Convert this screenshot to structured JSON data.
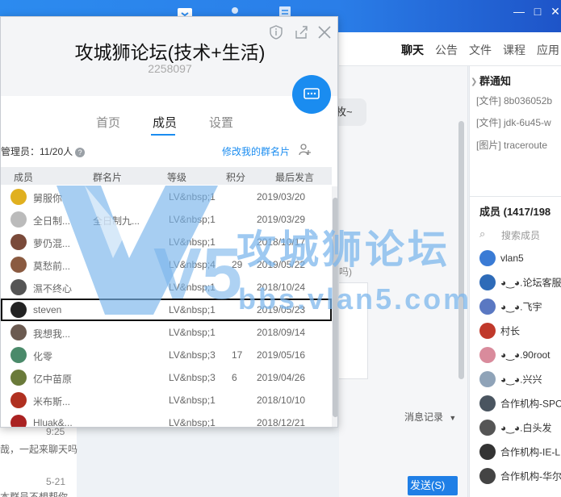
{
  "topbar": {
    "icons": [
      "chat-icon",
      "contacts-icon",
      "doc-icon"
    ],
    "window_controls": [
      "minimize-icon",
      "restore-icon",
      "close-icon"
    ]
  },
  "chat_tabs": [
    "聊天",
    "公告",
    "文件",
    "课程",
    "应用"
  ],
  "chat_bubble_text": "枚~",
  "input_partial": "吗)",
  "history_label": "消息记录",
  "send_label": "发送(S)",
  "left_list": {
    "line1": "哉，一起来聊天吗",
    "line2": "本群员不想帮你",
    "time1": "9:25",
    "time2": "5-21"
  },
  "notice": {
    "title": "群通知",
    "items": [
      "[文件] 8b036052b",
      "[文件] jdk-6u45-w",
      "[图片] traceroute"
    ]
  },
  "members_panel": {
    "header": "成员 (1417/198",
    "search_placeholder": "搜索成员",
    "items": [
      {
        "name": "vlan5",
        "color": "#3a7bd5"
      },
      {
        "name": "◕‿◕.论坛客服",
        "color": "#2e6bb8"
      },
      {
        "name": "◕‿◕.飞宇",
        "color": "#5a78c2"
      },
      {
        "name": "村长",
        "color": "#c0392b"
      },
      {
        "name": "◕‿◕.90root",
        "color": "#d98b9c"
      },
      {
        "name": "◕‿◕.兴兴",
        "color": "#8fa3b8"
      },
      {
        "name": "合作机构-SPO",
        "color": "#4a5560"
      },
      {
        "name": "◕‿◕.白头发",
        "color": "#555"
      },
      {
        "name": "合作机构-IE-L",
        "color": "#333"
      },
      {
        "name": "合作机构-华尔",
        "color": "#444"
      }
    ]
  },
  "popup": {
    "group_name": "攻城狮论坛(技术+生活)",
    "group_id": "2258097",
    "header_icons": [
      "info-icon",
      "share-icon",
      "close-icon"
    ],
    "tabs": [
      "首页",
      "成员",
      "设置"
    ],
    "active_tab": "成员",
    "admin_label": "管理员：11/20人",
    "edit_card_label": "修改我的群名片",
    "columns": [
      "成员",
      "群名片",
      "等级",
      "积分",
      "最后发言"
    ],
    "rows": [
      {
        "name": "舅服你",
        "card": "",
        "level": "LV&nbsp;1",
        "points": "",
        "last": "2019/03/20",
        "color": "#e0b020"
      },
      {
        "name": "全日制...",
        "card": "全日制九...",
        "level": "LV&nbsp;1",
        "points": "",
        "last": "2019/03/29",
        "color": "#bbbbbb"
      },
      {
        "name": "萝仍混...",
        "card": "",
        "level": "LV&nbsp;1",
        "points": "",
        "last": "2018/10/17",
        "color": "#7a4a3a"
      },
      {
        "name": "莫愁前...",
        "card": "",
        "level": "LV&nbsp;4",
        "points": "29",
        "last": "2019/05/22",
        "color": "#8a5a40"
      },
      {
        "name": "濕不终心",
        "card": "",
        "level": "LV&nbsp;1",
        "points": "",
        "last": "2018/10/24",
        "color": "#555555"
      },
      {
        "name": "steven",
        "card": "",
        "level": "LV&nbsp;1",
        "points": "",
        "last": "2019/05/23",
        "color": "#222222"
      },
      {
        "name": "我想我...",
        "card": "",
        "level": "LV&nbsp;1",
        "points": "",
        "last": "2018/09/14",
        "color": "#6b5a50"
      },
      {
        "name": "化零",
        "card": "",
        "level": "LV&nbsp;3",
        "points": "17",
        "last": "2019/05/16",
        "color": "#4a8a6a"
      },
      {
        "name": "亿中苗原",
        "card": "",
        "level": "LV&nbsp;3",
        "points": "6",
        "last": "2019/04/26",
        "color": "#6a7a3a"
      },
      {
        "name": "米布斯...",
        "card": "",
        "level": "LV&nbsp;1",
        "points": "",
        "last": "2018/10/10",
        "color": "#b03020"
      },
      {
        "name": "Hluak&...",
        "card": "",
        "level": "LV&nbsp;1",
        "points": "",
        "last": "2018/12/21",
        "color": "#aa2222"
      }
    ]
  },
  "watermark": {
    "text": "攻城狮论坛",
    "url": "bbs.vlan5.com",
    "logo_letters": "V5"
  }
}
